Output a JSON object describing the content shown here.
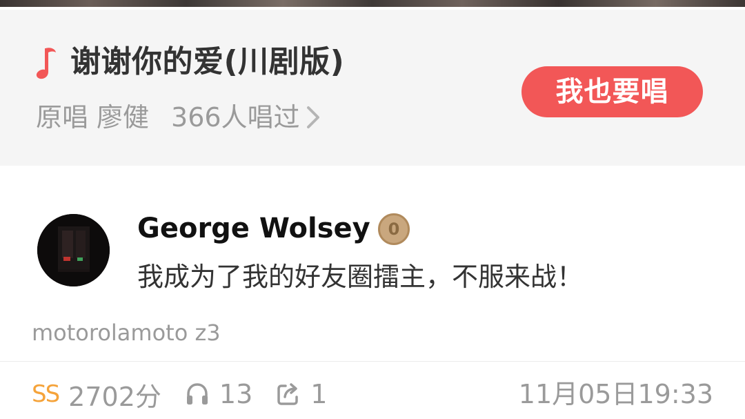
{
  "song": {
    "title": "谢谢你的爱(川剧版)",
    "original_label": "原唱",
    "original_singer": "廖健",
    "sung_count": "366人唱过",
    "sing_button_label": "我也要唱",
    "accent_color": "#f25757"
  },
  "post": {
    "user_name": "George Wolsey",
    "level": "0",
    "text": "我成为了我的好友圈擂主，不服来战！",
    "device": "motorolamoto z3",
    "score_badge": "SS",
    "score": "2702分",
    "listens": "13",
    "shares": "1",
    "timestamp": "11月05日19:33"
  },
  "icons": {
    "note": "music-note-icon",
    "chevron": "chevron-right-icon",
    "headphones": "headphones-icon",
    "share": "share-icon"
  }
}
